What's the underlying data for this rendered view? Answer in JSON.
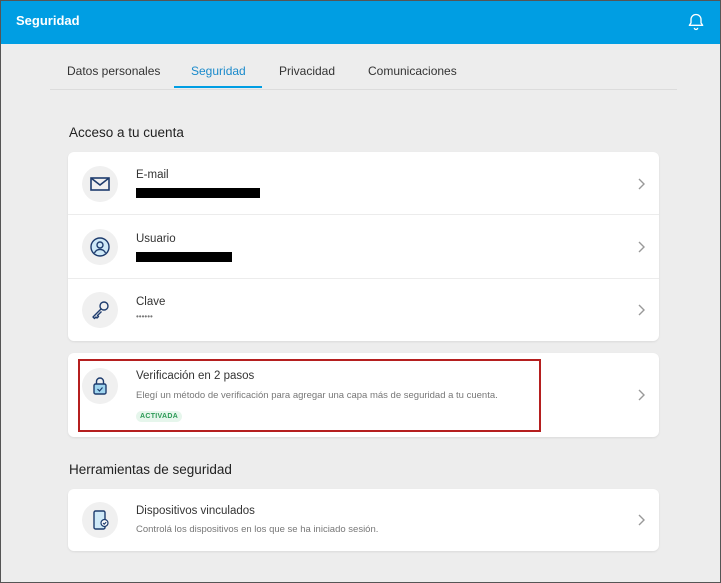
{
  "header": {
    "title": "Seguridad"
  },
  "tabs": [
    {
      "label": "Datos personales"
    },
    {
      "label": "Seguridad"
    },
    {
      "label": "Privacidad"
    },
    {
      "label": "Comunicaciones"
    }
  ],
  "access": {
    "title": "Acceso a tu cuenta",
    "email": {
      "label": "E-mail"
    },
    "user": {
      "label": "Usuario"
    },
    "password": {
      "label": "Clave",
      "value": "••••••"
    }
  },
  "two_step": {
    "label": "Verificación en 2 pasos",
    "description": "Elegí un método de verificación para agregar una capa más de seguridad a tu cuenta.",
    "badge": "ACTIVADA"
  },
  "tools": {
    "title": "Herramientas de seguridad",
    "devices": {
      "label": "Dispositivos vinculados",
      "description": "Controlá los dispositivos en los que se ha iniciado sesión."
    }
  },
  "colors": {
    "brand": "#009ee3",
    "highlight": "#b51f1f",
    "badge_green": "#2c9a56"
  }
}
